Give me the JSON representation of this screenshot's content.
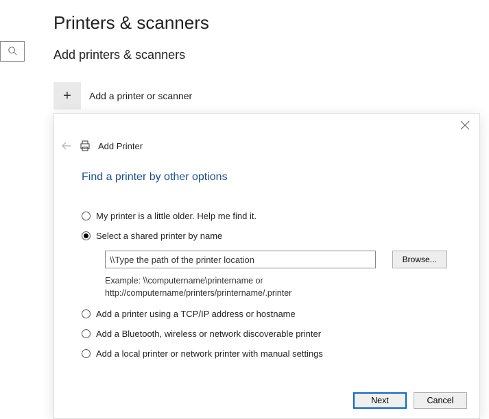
{
  "page": {
    "title": "Printers & scanners",
    "section": "Add printers & scanners",
    "add_label": "Add a printer or scanner"
  },
  "wizard": {
    "title": "Add Printer",
    "subtitle": "Find a printer by other options",
    "options": {
      "older": "My printer is a little older. Help me find it.",
      "shared": "Select a shared printer by name",
      "tcpip": "Add a printer using a TCP/IP address or hostname",
      "bluetooth": "Add a Bluetooth, wireless or network discoverable printer",
      "local": "Add a local printer or network printer with manual settings"
    },
    "path_value": "\\\\Type the path of the printer location",
    "example_line1": "Example: \\\\computername\\printername or",
    "example_line2": "http://computername/printers/printername/.printer",
    "browse_label": "Browse...",
    "next_label": "Next",
    "cancel_label": "Cancel"
  }
}
